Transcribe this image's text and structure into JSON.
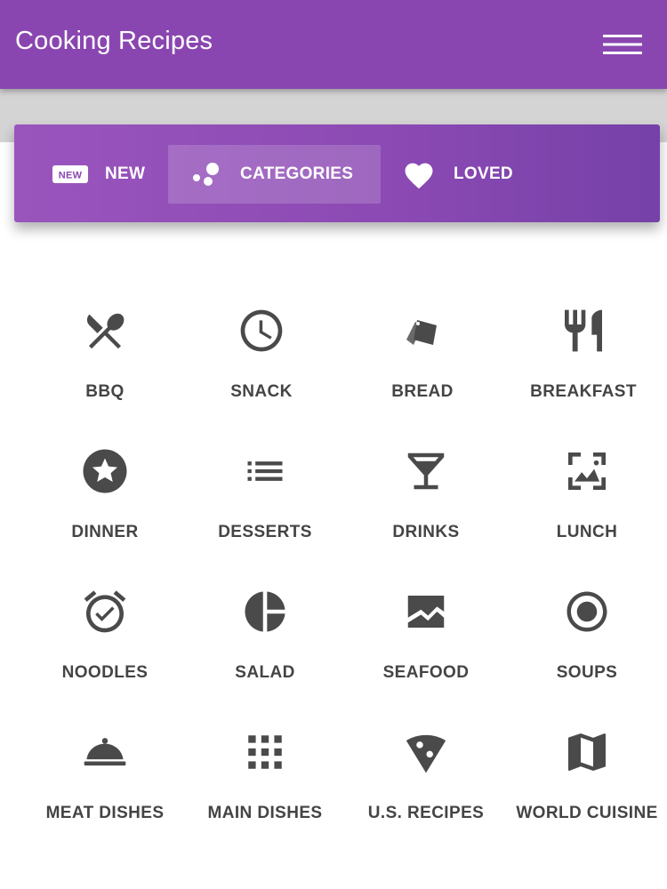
{
  "app": {
    "title": "Cooking Recipes"
  },
  "colors": {
    "primary": "#8a46b0",
    "icon": "#4a4a4a",
    "label": "#444444"
  },
  "tabs": [
    {
      "label": "NEW",
      "icon": "new-badge-icon"
    },
    {
      "label": "CATEGORIES",
      "icon": "bubbles-icon",
      "active": true
    },
    {
      "label": "LOVED",
      "icon": "heart-icon"
    }
  ],
  "categories": [
    {
      "label": "BBQ",
      "icon": "fork-spoon-icon"
    },
    {
      "label": "SNACK",
      "icon": "clock-icon"
    },
    {
      "label": "BREAD",
      "icon": "tags-icon"
    },
    {
      "label": "BREAKFAST",
      "icon": "restaurant-icon"
    },
    {
      "label": "DINNER",
      "icon": "star-circle-icon"
    },
    {
      "label": "DESSERTS",
      "icon": "list-icon"
    },
    {
      "label": "DRINKS",
      "icon": "cocktail-icon"
    },
    {
      "label": "LUNCH",
      "icon": "photo-frame-icon"
    },
    {
      "label": "NOODLES",
      "icon": "alarm-check-icon"
    },
    {
      "label": "SALAD",
      "icon": "pie-segment-icon"
    },
    {
      "label": "SEAFOOD",
      "icon": "wave-image-icon"
    },
    {
      "label": "SOUPS",
      "icon": "target-icon"
    },
    {
      "label": "MEAT DISHES",
      "icon": "cloche-icon"
    },
    {
      "label": "MAIN DISHES",
      "icon": "apps-grid-icon"
    },
    {
      "label": "U.S. RECIPES",
      "icon": "pizza-icon"
    },
    {
      "label": "WORLD CUISINE",
      "icon": "map-icon"
    }
  ]
}
